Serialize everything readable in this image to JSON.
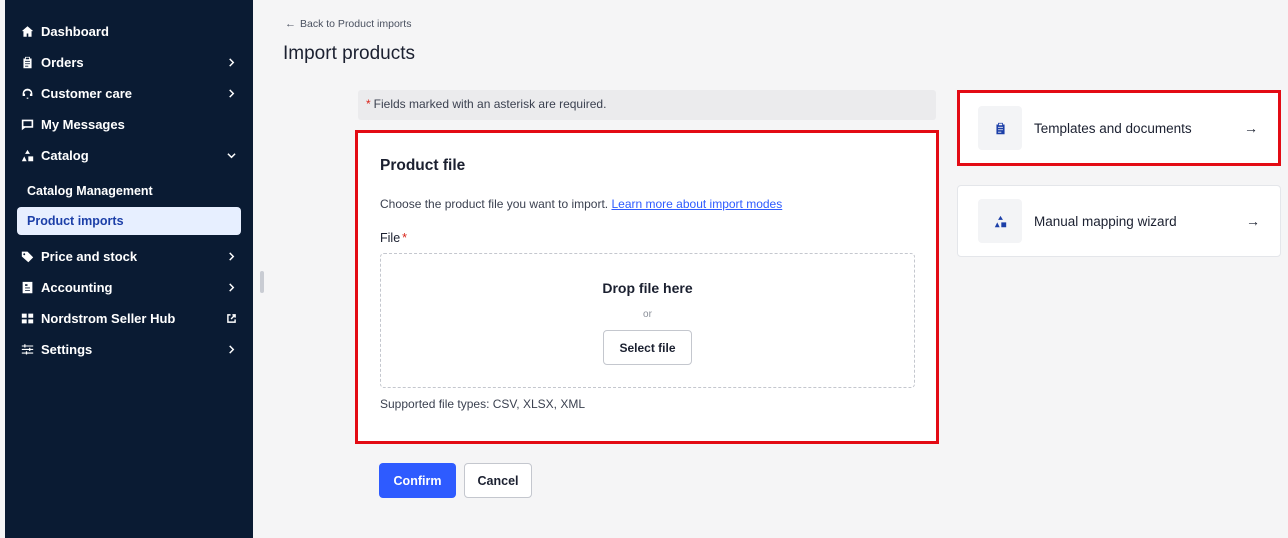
{
  "sidebar": {
    "items": [
      {
        "label": "Dashboard",
        "icon": "home-icon"
      },
      {
        "label": "Orders",
        "icon": "clipboard-icon"
      },
      {
        "label": "Customer care",
        "icon": "headset-icon"
      },
      {
        "label": "My Messages",
        "icon": "message-icon"
      },
      {
        "label": "Catalog",
        "icon": "shapes-icon"
      }
    ],
    "catalog_sub": [
      {
        "label": "Catalog Management"
      },
      {
        "label": "Product imports"
      }
    ],
    "items_after": [
      {
        "label": "Price and stock",
        "icon": "tag-icon"
      },
      {
        "label": "Accounting",
        "icon": "invoice-icon"
      },
      {
        "label": "Nordstrom Seller Hub",
        "icon": "grid-icon"
      },
      {
        "label": "Settings",
        "icon": "sliders-icon"
      }
    ]
  },
  "header": {
    "back_link": "Back to Product imports",
    "title": "Import products"
  },
  "required_note": "Fields marked with an asterisk are required.",
  "product_file": {
    "title": "Product file",
    "description": "Choose the product file you want to import.",
    "learn_more": "Learn more about import modes",
    "file_label": "File",
    "drop_title": "Drop file here",
    "or": "or",
    "select_button": "Select file",
    "supported": "Supported file types: CSV, XLSX, XML"
  },
  "actions": {
    "confirm": "Confirm",
    "cancel": "Cancel"
  },
  "side_cards": {
    "templates": "Templates and documents",
    "wizard": "Manual mapping wizard"
  },
  "colors": {
    "sidebar_bg": "#0a1b33",
    "primary": "#2e5bff",
    "highlight": "#e30b14"
  }
}
